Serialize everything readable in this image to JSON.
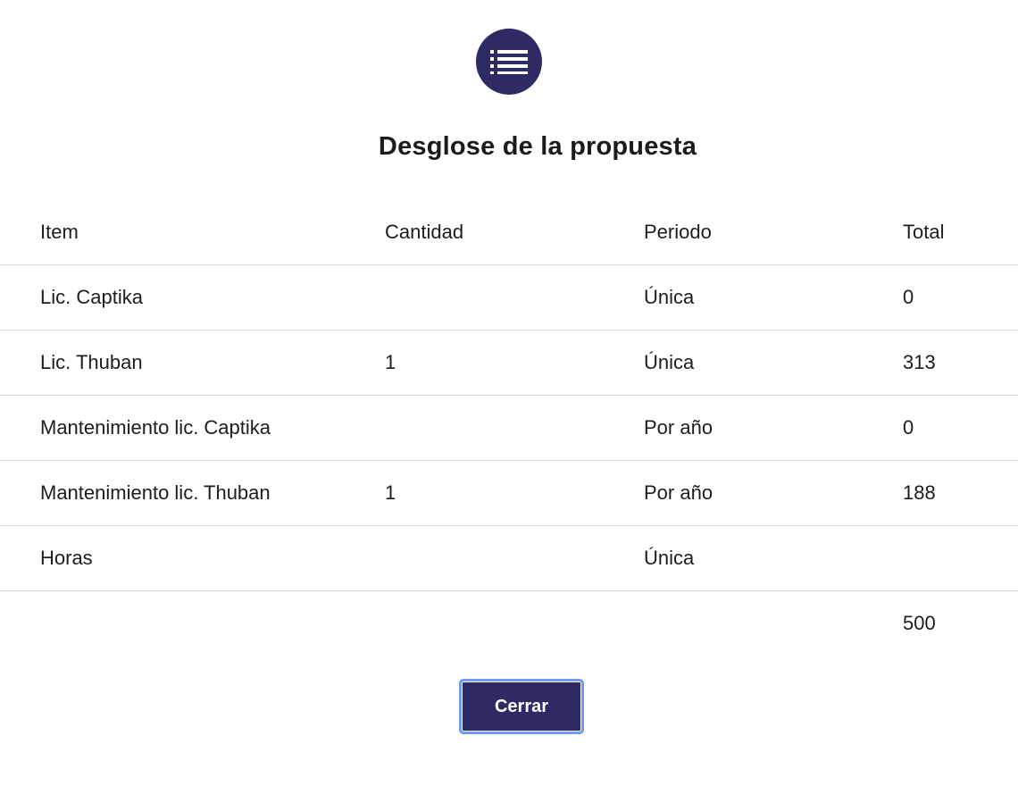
{
  "dialog": {
    "icon": "list-icon",
    "title": "Desglose de la propuesta",
    "close_label": "Cerrar"
  },
  "table": {
    "headers": [
      "Item",
      "Cantidad",
      "Periodo",
      "Total"
    ],
    "rows": [
      {
        "item": "Lic. Captika",
        "cantidad": "",
        "periodo": "Única",
        "total": "0"
      },
      {
        "item": "Lic. Thuban",
        "cantidad": "1",
        "periodo": "Única",
        "total": "313"
      },
      {
        "item": "Mantenimiento lic. Captika",
        "cantidad": "",
        "periodo": "Por año",
        "total": "0"
      },
      {
        "item": "Mantenimiento lic. Thuban",
        "cantidad": "1",
        "periodo": "Por año",
        "total": "188"
      },
      {
        "item": "Horas",
        "cantidad": "",
        "periodo": "Única",
        "total": ""
      }
    ],
    "grand_total": "500"
  },
  "colors": {
    "primary": "#2e2a64",
    "focus_ring": "#6f9bf2",
    "divider": "#d9d9d9"
  }
}
